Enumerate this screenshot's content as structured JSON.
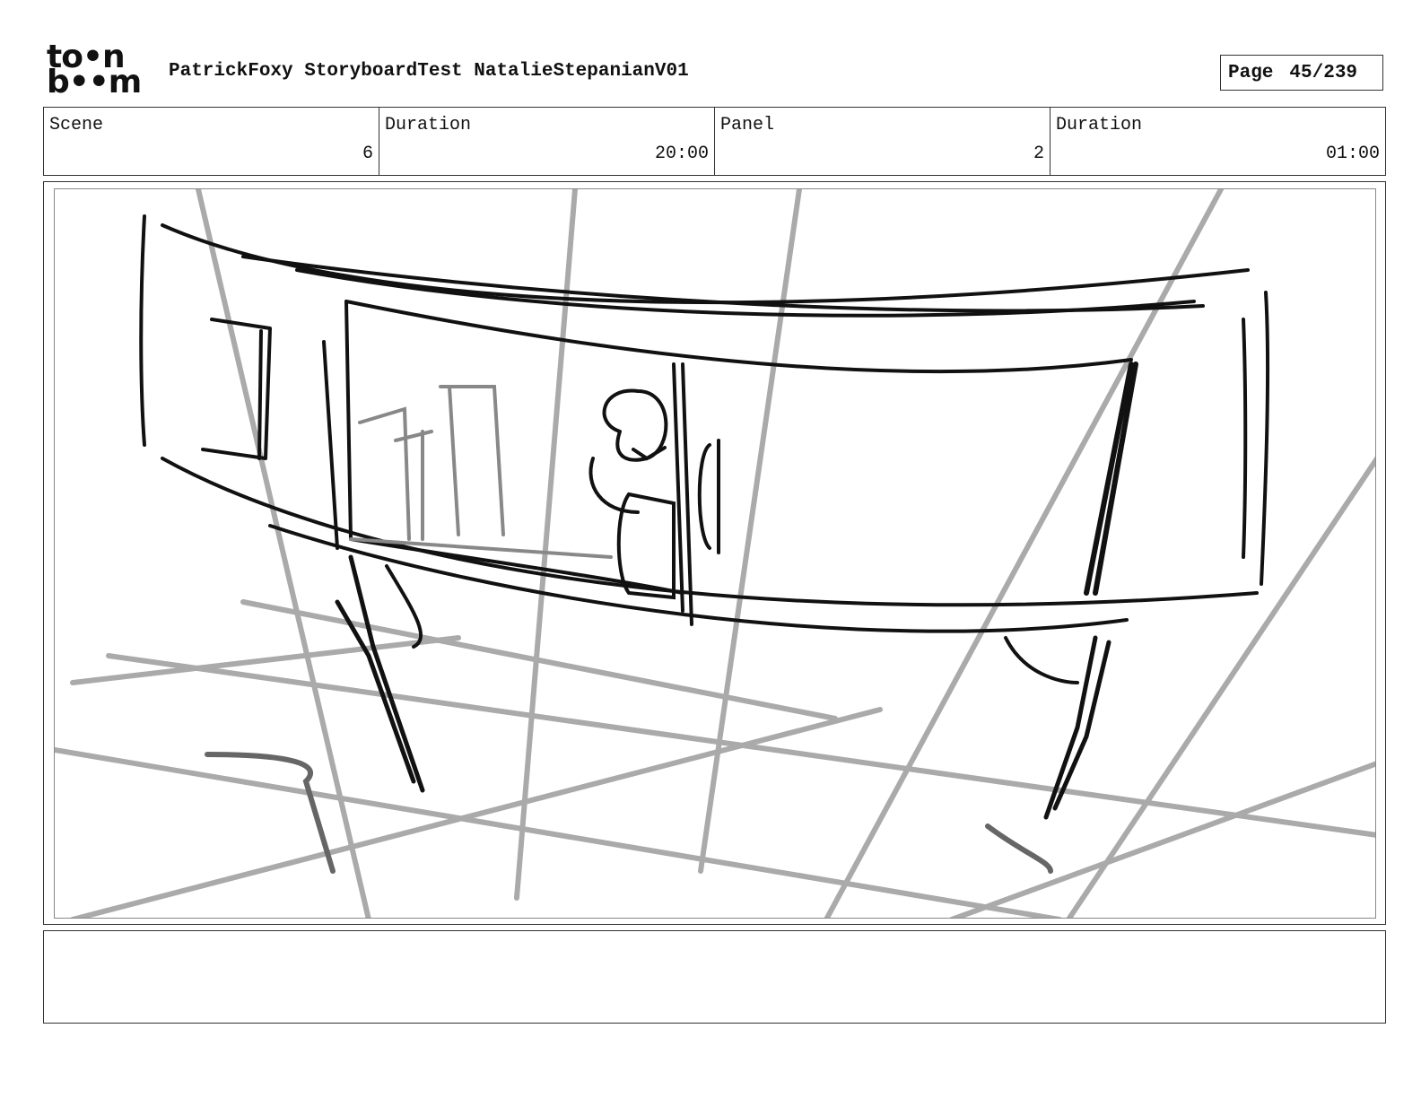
{
  "logo": {
    "line1": "to•n",
    "line2": "b••m"
  },
  "header": {
    "title": "PatrickFoxy StoryboardTest NatalieStepanianV01",
    "page_label": "Page",
    "page_value": "45/239"
  },
  "info": {
    "scene_label": "Scene",
    "scene_value": "6",
    "scene_duration_label": "Duration",
    "scene_duration_value": "20:00",
    "panel_label": "Panel",
    "panel_value": "2",
    "panel_duration_label": "Duration",
    "panel_duration_value": "01:00"
  },
  "notes": {
    "text": ""
  },
  "colors": {
    "ink": "#111111",
    "guide": "#aaaaaa",
    "frame": "#333333"
  },
  "icons": {
    "logo": "toonboom-logo"
  }
}
